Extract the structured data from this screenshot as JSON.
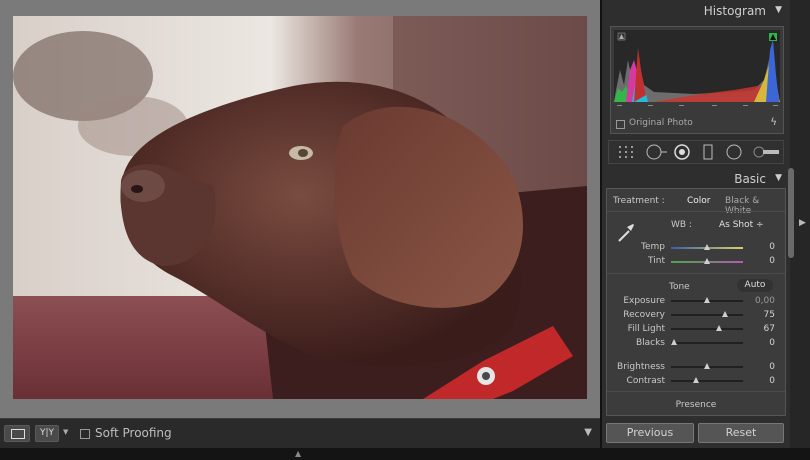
{
  "panels": {
    "histogram": {
      "title": "Histogram",
      "original_photo_label": "Original Photo"
    },
    "basic": {
      "title": "Basic",
      "treatment_label": "Treatment :",
      "treatment_color": "Color",
      "treatment_bw": "Black & White",
      "wb_label": "WB :",
      "wb_value": "As Shot ÷",
      "temp": {
        "label": "Temp",
        "value": "0",
        "level": 0.5
      },
      "tint": {
        "label": "Tint",
        "value": "0",
        "level": 0.5
      },
      "tone_label": "Tone",
      "auto_label": "Auto",
      "exposure": {
        "label": "Exposure",
        "value": "0,00",
        "level": 0.5
      },
      "recovery": {
        "label": "Recovery",
        "value": "75",
        "level": 0.75
      },
      "fill_light": {
        "label": "Fill Light",
        "value": "67",
        "level": 0.67
      },
      "blacks": {
        "label": "Blacks",
        "value": "0",
        "level": 0.0
      },
      "brightness": {
        "label": "Brightness",
        "value": "0",
        "level": 0.5
      },
      "contrast": {
        "label": "Contrast",
        "value": "0",
        "level": 0.35
      },
      "presence_label": "Presence"
    }
  },
  "toolbar": {
    "compare_label": "Y|Y",
    "soft_proofing_label": "Soft Proofing"
  },
  "buttons": {
    "previous": "Previous",
    "reset": "Reset"
  },
  "colors": {
    "panel_bg": "#2e2e2e",
    "collar_red": "#c0282a"
  }
}
